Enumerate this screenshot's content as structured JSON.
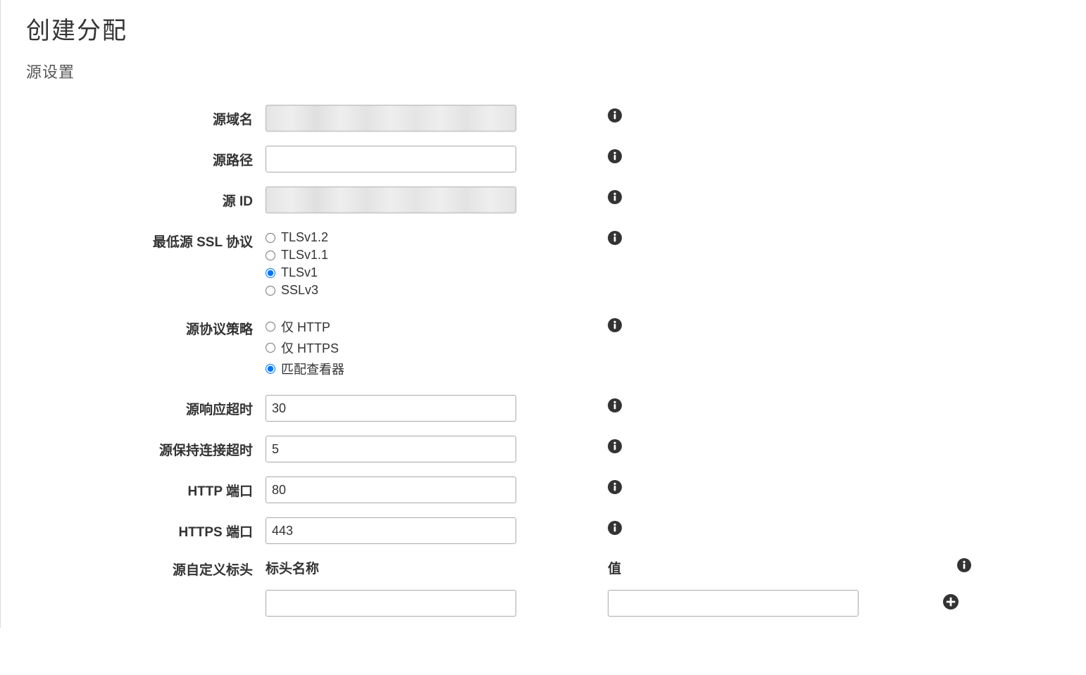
{
  "page_title": "创建分配",
  "section_title": "源设置",
  "fields": {
    "origin_domain": {
      "label": "源域名",
      "value": ""
    },
    "origin_path": {
      "label": "源路径",
      "value": ""
    },
    "origin_id": {
      "label": "源 ID",
      "value": ""
    },
    "min_ssl": {
      "label": "最低源 SSL 协议",
      "options": [
        "TLSv1.2",
        "TLSv1.1",
        "TLSv1",
        "SSLv3"
      ],
      "selected": "TLSv1"
    },
    "protocol_policy": {
      "label": "源协议策略",
      "options": [
        "仅 HTTP",
        "仅 HTTPS",
        "匹配查看器"
      ],
      "selected": "匹配查看器"
    },
    "response_timeout": {
      "label": "源响应超时",
      "value": "30"
    },
    "keepalive_timeout": {
      "label": "源保持连接超时",
      "value": "5"
    },
    "http_port": {
      "label": "HTTP 端口",
      "value": "80"
    },
    "https_port": {
      "label": "HTTPS 端口",
      "value": "443"
    },
    "custom_headers": {
      "label": "源自定义标头",
      "header_name_label": "标头名称",
      "header_value_label": "值",
      "header_name_value": "",
      "header_value_value": ""
    }
  }
}
